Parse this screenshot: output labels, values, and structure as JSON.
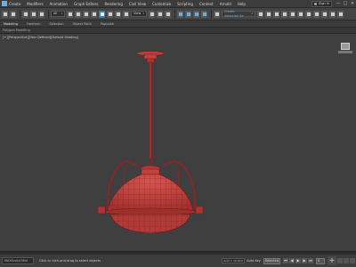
{
  "menu": {
    "items": [
      "Create",
      "Modifiers",
      "Animation",
      "Graph Editors",
      "Rendering",
      "Civil View",
      "Customize",
      "Scripting",
      "Content",
      "Arnold",
      "Help"
    ],
    "sign_in": "Sign In",
    "window_controls": [
      "—",
      "□",
      "×"
    ]
  },
  "toolbar": {
    "filter_value": "All",
    "view_value": "View",
    "selection_set_placeholder": "Create Selection Se"
  },
  "ribbon": {
    "tabs": [
      "Modeling",
      "Freeform",
      "Selection",
      "Object Paint",
      "Populate"
    ],
    "subtabs": [
      "Polygon Modeling"
    ]
  },
  "viewport": {
    "label": "[+][Perspective][User Defined][Default Shading]",
    "lamp_color": "#c4403f",
    "lamp_dark": "#8a2625"
  },
  "status": {
    "maxscript": "MAXScript Mini",
    "message": "Click or click-and-drag to select objects",
    "grid": "Grid = 10.0cm",
    "auto_key": "Auto Key",
    "selected": "Selected",
    "set_key": "Set Key",
    "key_filters": "Key Filters...",
    "frame": "0"
  }
}
